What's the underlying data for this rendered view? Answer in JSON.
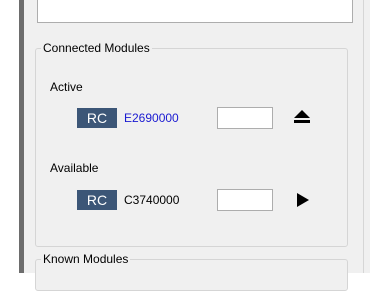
{
  "colors": {
    "badge_bg": "#3c5677",
    "active_id": "#1a1ad1",
    "available_id": "#000000"
  },
  "connected_modules": {
    "title": "Connected Modules",
    "active": {
      "label": "Active",
      "badge": "RC",
      "module_id": "E2690000",
      "field_value": "",
      "action_icon": "eject-icon"
    },
    "available": {
      "label": "Available",
      "badge": "RC",
      "module_id": "C3740000",
      "field_value": "",
      "action_icon": "play-icon"
    }
  },
  "known_modules": {
    "title": "Known Modules"
  }
}
